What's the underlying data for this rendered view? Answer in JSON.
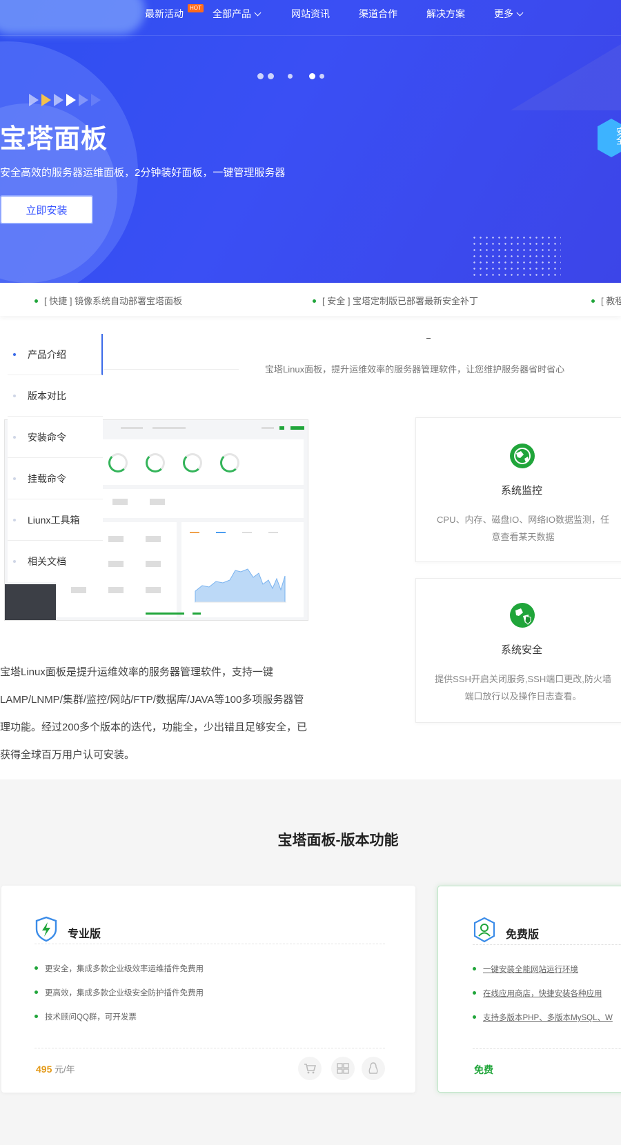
{
  "nav": {
    "items": [
      "最新活动",
      "全部产品",
      "网站资讯",
      "渠道合作",
      "解决方案",
      "更多"
    ],
    "hot_badge": "HOT"
  },
  "hero": {
    "title": "宝塔面板",
    "subtitle": "安全高效的服务器运维面板，2分钟装好面板，一键管理服务器",
    "install_button": "立即安装",
    "side_badge": "安全",
    "slide_count": 5,
    "active_slide": 4
  },
  "news": [
    "[ 快捷 ] 镜像系统自动部署宝塔面板",
    "[ 安全 ] 宝塔定制版已部署最新安全补丁",
    "[ 教程"
  ],
  "sidebar": {
    "items": [
      "产品介绍",
      "版本对比",
      "安装命令",
      "挂载命令",
      "Liunx工具箱",
      "相关文档"
    ],
    "active_index": 0
  },
  "intro": {
    "dash": "-",
    "description": "宝塔Linux面板，提升运维效率的服务器管理软件，让您维护服务器省时省心",
    "body": "宝塔Linux面板是提升运维效率的服务器管理软件，支持一键LAMP/LNMP/集群/监控/网站/FTP/数据库/JAVA等100多项服务器管理功能。经过200多个版本的迭代，功能全，少出错且足够安全，已获得全球百万用户认可安装。"
  },
  "features": [
    {
      "title": "系统监控",
      "desc": "CPU、内存、磁盘IO、网络IO数据监测，任意查看某天数据",
      "icon": "globe-monitor-icon"
    },
    {
      "title": "系统安全",
      "desc": "提供SSH开启关闭服务,SSH端口更改,防火墙端口放行以及操作日志查看。",
      "icon": "globe-shield-icon"
    }
  ],
  "versions": {
    "section_title": "宝塔面板-版本功能",
    "pro": {
      "name": "专业版",
      "features": [
        "更安全，集成多款企业级效率运维插件免费用",
        "更高效，集成多款企业级安全防护插件免费用",
        "技术顾问QQ群，可开发票"
      ],
      "price": "495",
      "unit": "元/年",
      "buy_icons": [
        "cart-icon",
        "windows-icon",
        "linux-icon"
      ]
    },
    "free": {
      "name": "免费版",
      "features": [
        "一键安装全能网站运行环境",
        "在线应用商店，快捷安装各种应用",
        "支持多版本PHP、多版本MySQL、W"
      ],
      "price_label": "免费"
    }
  },
  "colors": {
    "accent": "#3754ff",
    "green": "#20a53a",
    "hero_bg": "#3a4ff4",
    "price": "#e49b1b"
  }
}
